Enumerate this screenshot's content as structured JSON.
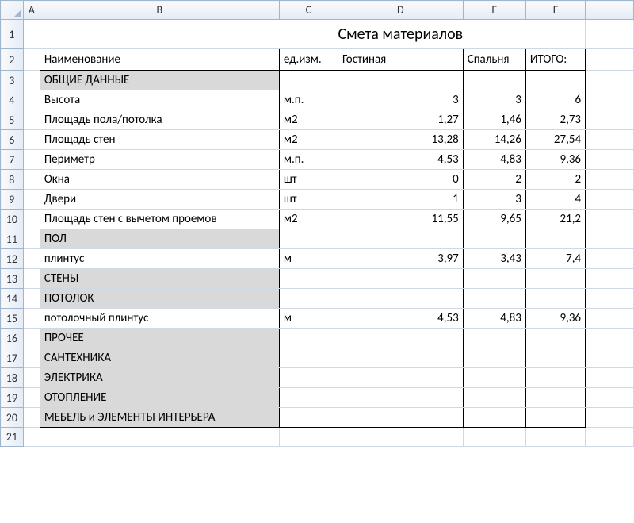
{
  "columns": [
    "A",
    "B",
    "C",
    "D",
    "E",
    "F"
  ],
  "title": "Смета материалов",
  "headers": {
    "name": "Наименование",
    "unit": "ед.изм.",
    "living": "Гостиная",
    "bedroom": "Спальня",
    "total": "ИТОГО:"
  },
  "rows": {
    "r3": {
      "b": "ОБЩИЕ ДАННЫЕ",
      "shaded": true
    },
    "r4": {
      "b": "Высота",
      "c": "м.п.",
      "d": "3",
      "e": "3",
      "f": "6"
    },
    "r5": {
      "b": "Площадь пола/потолка",
      "c": "м2",
      "d": "1,27",
      "e": "1,46",
      "f": "2,73"
    },
    "r6": {
      "b": "Площадь стен",
      "c": "м2",
      "d": "13,28",
      "e": "14,26",
      "f": "27,54"
    },
    "r7": {
      "b": "Периметр",
      "c": "м.п.",
      "d": "4,53",
      "e": "4,83",
      "f": "9,36"
    },
    "r8": {
      "b": "Окна",
      "c": "шт",
      "d": "0",
      "e": "2",
      "f": "2"
    },
    "r9": {
      "b": "Двери",
      "c": "шт",
      "d": "1",
      "e": "3",
      "f": "4"
    },
    "r10": {
      "b": "Площадь стен с вычетом проемов",
      "c": "м2",
      "d": "11,55",
      "e": "9,65",
      "f": "21,2"
    },
    "r11": {
      "b": "ПОЛ",
      "shaded": true
    },
    "r12": {
      "b": "плинтус",
      "c": "м",
      "d": "3,97",
      "e": "3,43",
      "f": "7,4"
    },
    "r13": {
      "b": "СТЕНЫ",
      "shaded": true
    },
    "r14": {
      "b": "ПОТОЛОК",
      "shaded": true
    },
    "r15": {
      "b": "потолочный плинтус",
      "c": "м",
      "d": "4,53",
      "e": "4,83",
      "f": "9,36"
    },
    "r16": {
      "b": "ПРОЧЕЕ",
      "shaded": true
    },
    "r17": {
      "b": "САНТЕХНИКА",
      "shaded": true
    },
    "r18": {
      "b": "ЭЛЕКТРИКА",
      "shaded": true
    },
    "r19": {
      "b": "ОТОПЛЕНИЕ",
      "shaded": true
    },
    "r20": {
      "b": "МЕБЕЛЬ и ЭЛЕМЕНТЫ ИНТЕРЬЕРА",
      "shaded": true
    }
  }
}
